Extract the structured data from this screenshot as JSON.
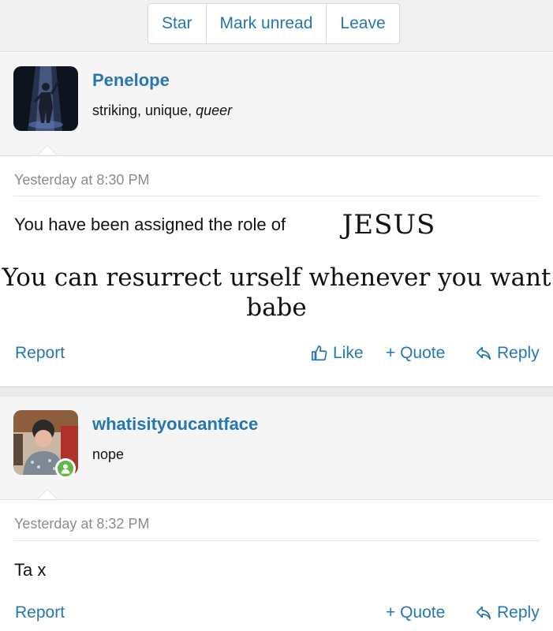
{
  "toolbar": {
    "star_label": "Star",
    "mark_unread_label": "Mark unread",
    "leave_label": "Leave"
  },
  "posts": [
    {
      "username": "Penelope",
      "user_title_plain": "striking, unique, ",
      "user_title_emph": "queer",
      "timestamp": "Yesterday at 8:30 PM",
      "message": "You have been assigned the role of",
      "role_word": "JESUS",
      "overlay_line1": "You can resurrect urself whenever you want",
      "overlay_line2": "babe",
      "report_label": "Report",
      "like_label": "Like",
      "quote_label": "+ Quote",
      "reply_label": "Reply"
    },
    {
      "username": "whatisityoucantface",
      "user_title_plain": "nope",
      "timestamp": "Yesterday at 8:32 PM",
      "message": "Ta x",
      "report_label": "Report",
      "quote_label": "+ Quote",
      "reply_label": "Reply",
      "online": true
    }
  ],
  "colors": {
    "link": "#2577b1",
    "online": "#63b64a",
    "header_bg": "#f5f5f5"
  },
  "icons": [
    "thumbs-up-icon",
    "reply-arrow-icon",
    "user-online-icon"
  ]
}
